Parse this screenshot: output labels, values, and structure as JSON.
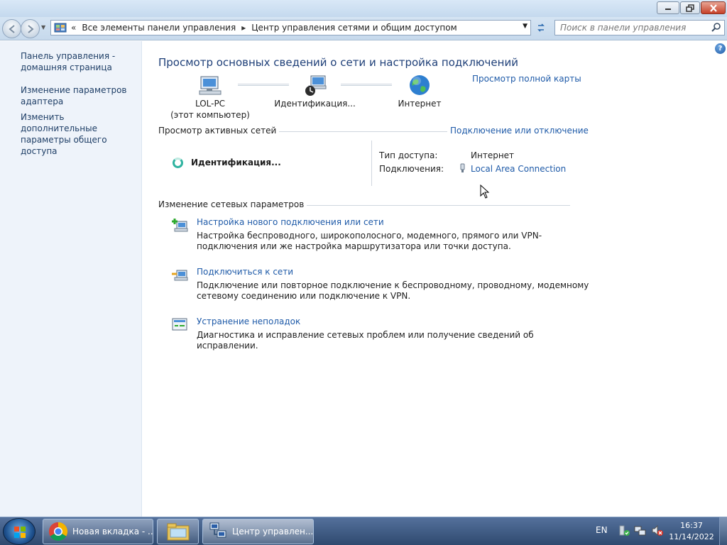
{
  "window": {
    "address_segments": [
      "Все элементы панели управления",
      "Центр управления сетями и общим доступом"
    ],
    "search_placeholder": "Поиск в панели управления"
  },
  "sidebar": {
    "items": [
      {
        "label": "Панель управления - домашняя страница"
      },
      {
        "label": "Изменение параметров адаптера"
      },
      {
        "label": "Изменить дополнительные параметры общего доступа"
      }
    ]
  },
  "main": {
    "title": "Просмотр основных сведений о сети и настройка подключений",
    "full_map_link": "Просмотр полной карты",
    "map_nodes": [
      {
        "label": "LOL-PC",
        "sublabel": "(этот компьютер)",
        "icon": "computer-icon"
      },
      {
        "label": "Идентификация...",
        "icon": "unidentified-network-icon"
      },
      {
        "label": "Интернет",
        "icon": "globe-icon"
      }
    ],
    "active_networks": {
      "label": "Просмотр активных сетей",
      "connect_link": "Подключение или отключение",
      "network_name": "Идентификация...",
      "access_type_label": "Тип доступа:",
      "access_type_value": "Интернет",
      "connections_label": "Подключения:",
      "connections_value": "Local Area Connection"
    },
    "change_settings": {
      "label": "Изменение сетевых параметров",
      "tasks": [
        {
          "link": "Настройка нового подключения или сети",
          "desc": "Настройка беспроводного, широкополосного, модемного, прямого или VPN-подключения или же настройка маршрутизатора или точки доступа.",
          "icon": "new-connection-icon"
        },
        {
          "link": "Подключиться к сети",
          "desc": "Подключение или повторное подключение к беспроводному, проводному, модемному сетевому соединению или подключение к VPN.",
          "icon": "connect-network-icon"
        },
        {
          "link": "Устранение неполадок",
          "desc": "Диагностика и исправление сетевых проблем или получение сведений об исправлении.",
          "icon": "troubleshoot-icon"
        }
      ]
    }
  },
  "taskbar": {
    "chrome_label": "Новая вкладка - ...",
    "netcenter_label": "Центр управлен...",
    "lang": "EN",
    "time": "16:37",
    "date": "11/14/2022"
  },
  "colors": {
    "link": "#1e5aa8",
    "title": "#1e3f78",
    "sidebar_bg": "#eef3fa"
  }
}
